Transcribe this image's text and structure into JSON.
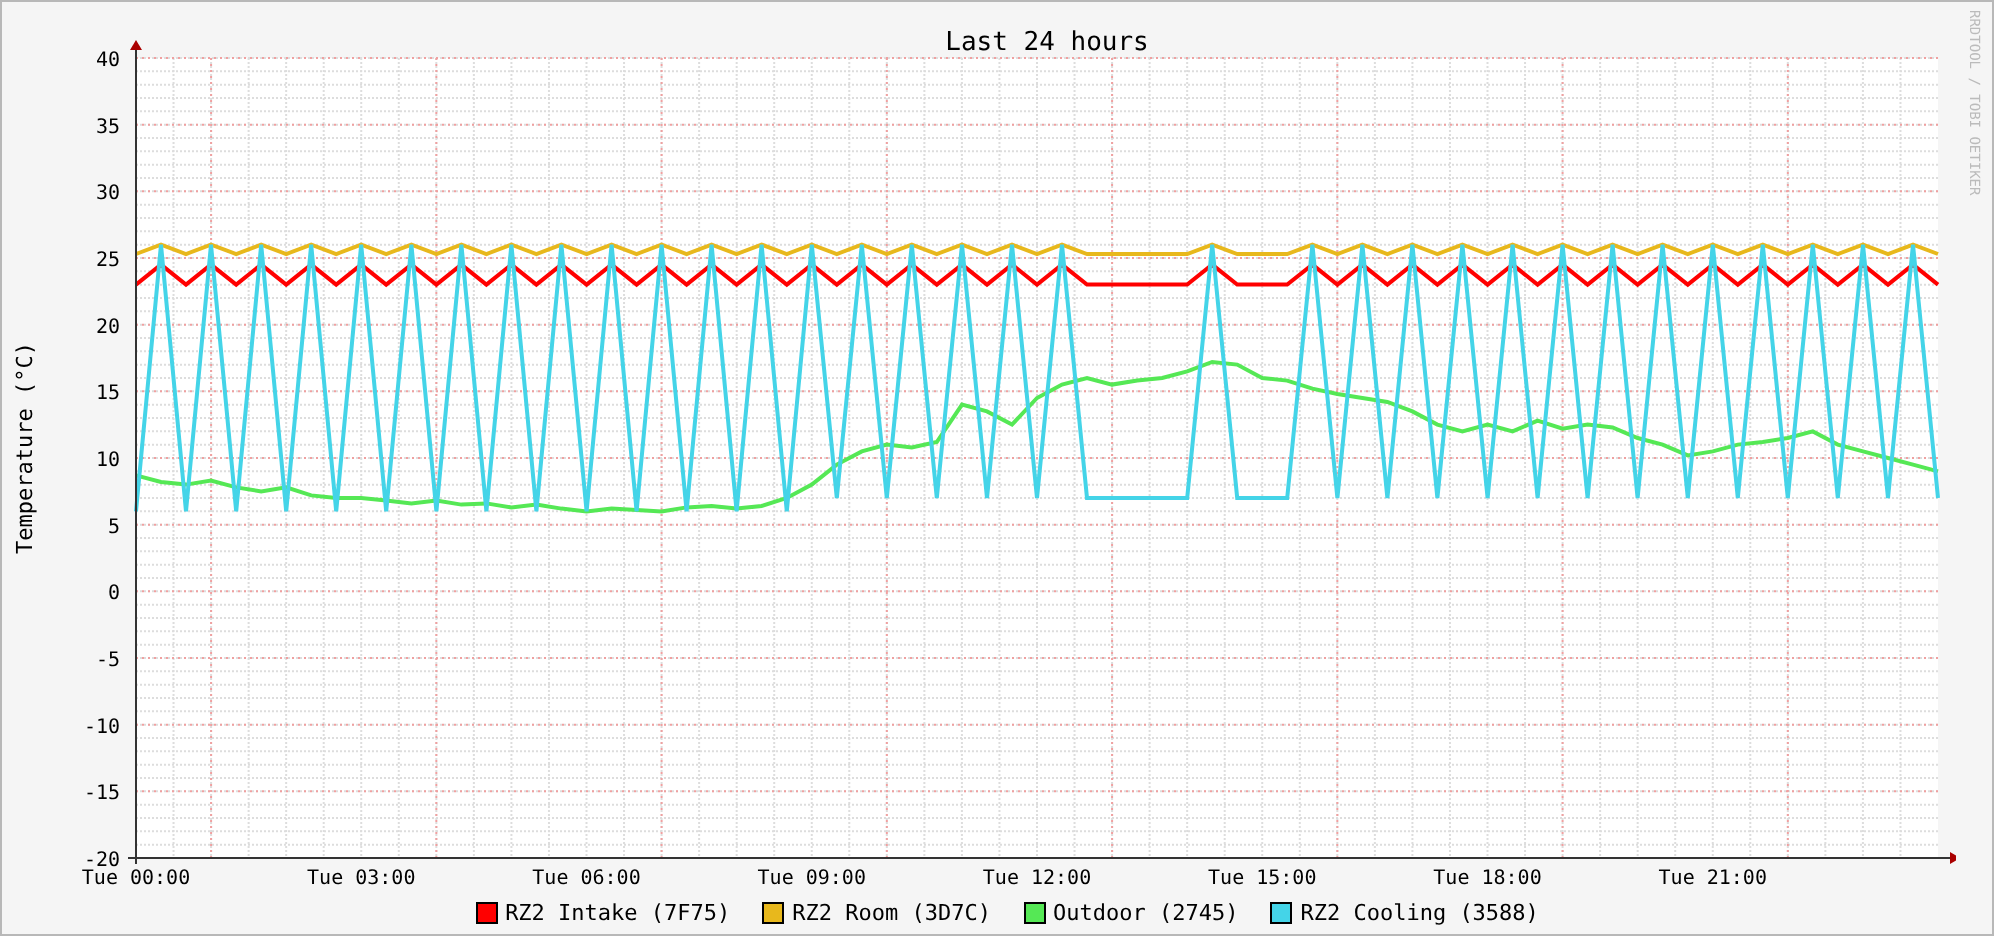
{
  "graph": {
    "credit": "RRDTOOL / TOBI OETIKER",
    "chart_data": {
      "type": "line",
      "title": "Last 24 hours",
      "ylabel": "Temperature (°C)",
      "categories": [
        "Tue 00:00",
        null,
        null,
        null,
        null,
        null,
        null,
        null,
        null,
        "Tue 03:00",
        null,
        null,
        null,
        null,
        null,
        null,
        null,
        null,
        "Tue 06:00",
        null,
        null,
        null,
        null,
        null,
        null,
        null,
        null,
        "Tue 09:00",
        null,
        null,
        null,
        null,
        null,
        null,
        null,
        null,
        "Tue 12:00",
        null,
        null,
        null,
        null,
        null,
        null,
        null,
        null,
        "Tue 15:00",
        null,
        null,
        null,
        null,
        null,
        null,
        null,
        null,
        "Tue 18:00",
        null,
        null,
        null,
        null,
        null,
        null,
        null,
        null,
        "Tue 21:00",
        null,
        null,
        null,
        null,
        null,
        null,
        null,
        null,
        null
      ],
      "ylim": [
        -20,
        40
      ],
      "grid": true,
      "yticks": [
        -20,
        -15,
        -10,
        -5,
        0,
        5,
        10,
        15,
        20,
        25,
        30,
        35,
        40
      ],
      "series": [
        {
          "name": "RZ2 Intake (7F75)",
          "color": "#ff0000",
          "values": [
            23,
            24.5,
            23,
            24.5,
            23,
            24.5,
            23,
            24.5,
            23,
            24.5,
            23,
            24.5,
            23,
            24.5,
            23,
            24.5,
            23,
            24.5,
            23,
            24.5,
            23,
            24.5,
            23,
            24.5,
            23,
            24.5,
            23,
            24.5,
            23,
            24.5,
            23,
            24.5,
            23,
            24.5,
            23,
            24.5,
            23,
            24.5,
            23,
            23,
            23,
            23,
            23,
            24.5,
            23,
            23,
            23,
            24.5,
            23,
            24.5,
            23,
            24.5,
            23,
            24.5,
            23,
            24.5,
            23,
            24.5,
            23,
            24.5,
            23,
            24.5,
            23,
            24.5,
            23,
            24.5,
            23,
            24.5,
            23,
            24.5,
            23,
            24.5,
            23
          ]
        },
        {
          "name": "RZ2 Room (3D7C)",
          "color": "#e8b81c",
          "values": [
            25.3,
            26,
            25.3,
            26,
            25.3,
            26,
            25.3,
            26,
            25.3,
            26,
            25.3,
            26,
            25.3,
            26,
            25.3,
            26,
            25.3,
            26,
            25.3,
            26,
            25.3,
            26,
            25.3,
            26,
            25.3,
            26,
            25.3,
            26,
            25.3,
            26,
            25.3,
            26,
            25.3,
            26,
            25.3,
            26,
            25.3,
            26,
            25.3,
            25.3,
            25.3,
            25.3,
            25.3,
            26,
            25.3,
            25.3,
            25.3,
            26,
            25.3,
            26,
            25.3,
            26,
            25.3,
            26,
            25.3,
            26,
            25.3,
            26,
            25.3,
            26,
            25.3,
            26,
            25.3,
            26,
            25.3,
            26,
            25.3,
            26,
            25.3,
            26,
            25.3,
            26,
            25.3
          ]
        },
        {
          "name": "Outdoor (2745)",
          "color": "#55e855",
          "values": [
            8.7,
            8.2,
            8,
            8.3,
            7.8,
            7.5,
            7.8,
            7.2,
            7,
            7,
            6.8,
            6.6,
            6.8,
            6.5,
            6.6,
            6.3,
            6.5,
            6.2,
            6,
            6.2,
            6.1,
            6,
            6.3,
            6.4,
            6.2,
            6.4,
            7,
            8,
            9.5,
            10.5,
            11,
            10.8,
            11.2,
            14,
            13.5,
            12.5,
            14.5,
            15.5,
            16,
            15.5,
            15.8,
            16,
            16.5,
            17.2,
            17,
            16,
            15.8,
            15.2,
            14.8,
            14.5,
            14.2,
            13.5,
            12.5,
            12,
            12.5,
            12,
            12.8,
            12.2,
            12.5,
            12.3,
            11.5,
            11,
            10.2,
            10.5,
            11,
            11.2,
            11.5,
            12,
            11,
            10.5,
            10,
            9.5,
            9
          ]
        },
        {
          "name": "RZ2 Cooling (3588)",
          "color": "#44d4e8",
          "values": [
            6,
            26,
            6,
            26,
            6,
            26,
            6,
            26,
            6,
            26,
            6,
            26,
            6,
            26,
            6,
            26,
            6,
            26,
            6,
            26,
            6,
            26,
            6,
            26,
            6,
            26,
            6,
            26,
            7,
            26,
            7,
            26,
            7,
            26,
            7,
            26,
            7,
            26,
            7,
            7,
            7,
            7,
            7,
            26,
            7,
            7,
            7,
            26,
            7,
            26,
            7,
            26,
            7,
            26,
            7,
            26,
            7,
            26,
            7,
            26,
            7,
            26,
            7,
            26,
            7,
            26,
            7,
            26,
            7,
            26,
            7,
            26,
            7
          ]
        }
      ]
    }
  }
}
